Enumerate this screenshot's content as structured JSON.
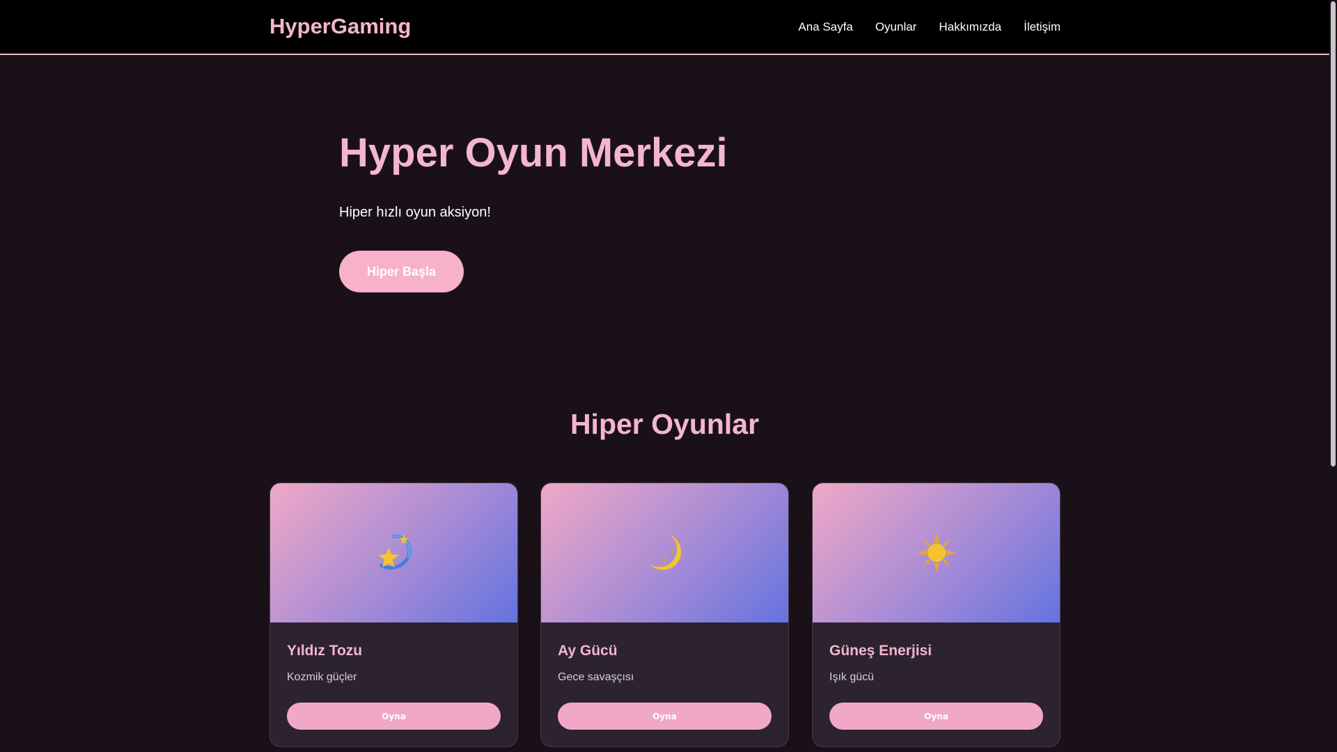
{
  "header": {
    "brand": "HyperGaming",
    "nav": [
      "Ana Sayfa",
      "Oyunlar",
      "Hakkımızda",
      "İletişim"
    ]
  },
  "hero": {
    "title": "Hyper Oyun Merkezi",
    "subtitle": "Hiper hızlı oyun aksiyon!",
    "cta": "Hiper Başla"
  },
  "games_section": {
    "title": "Hiper Oyunlar",
    "cards": [
      {
        "icon": "dizzy-star-icon",
        "title": "Yıldız Tozu",
        "description": "Kozmik güçler",
        "button": "Oyna"
      },
      {
        "icon": "crescent-moon-icon",
        "title": "Ay Gücü",
        "description": "Gece savaşçısı",
        "button": "Oyna"
      },
      {
        "icon": "sun-icon",
        "title": "Güneş Enerjisi",
        "description": "Işık gücü",
        "button": "Oyna"
      }
    ]
  },
  "colors": {
    "accent": "#f4b6cd",
    "background": "#1a1018",
    "header_bg": "#000000",
    "card_bg": "#2c2230",
    "gradient_start": "#f0a8c6",
    "gradient_end": "#6373e0"
  }
}
